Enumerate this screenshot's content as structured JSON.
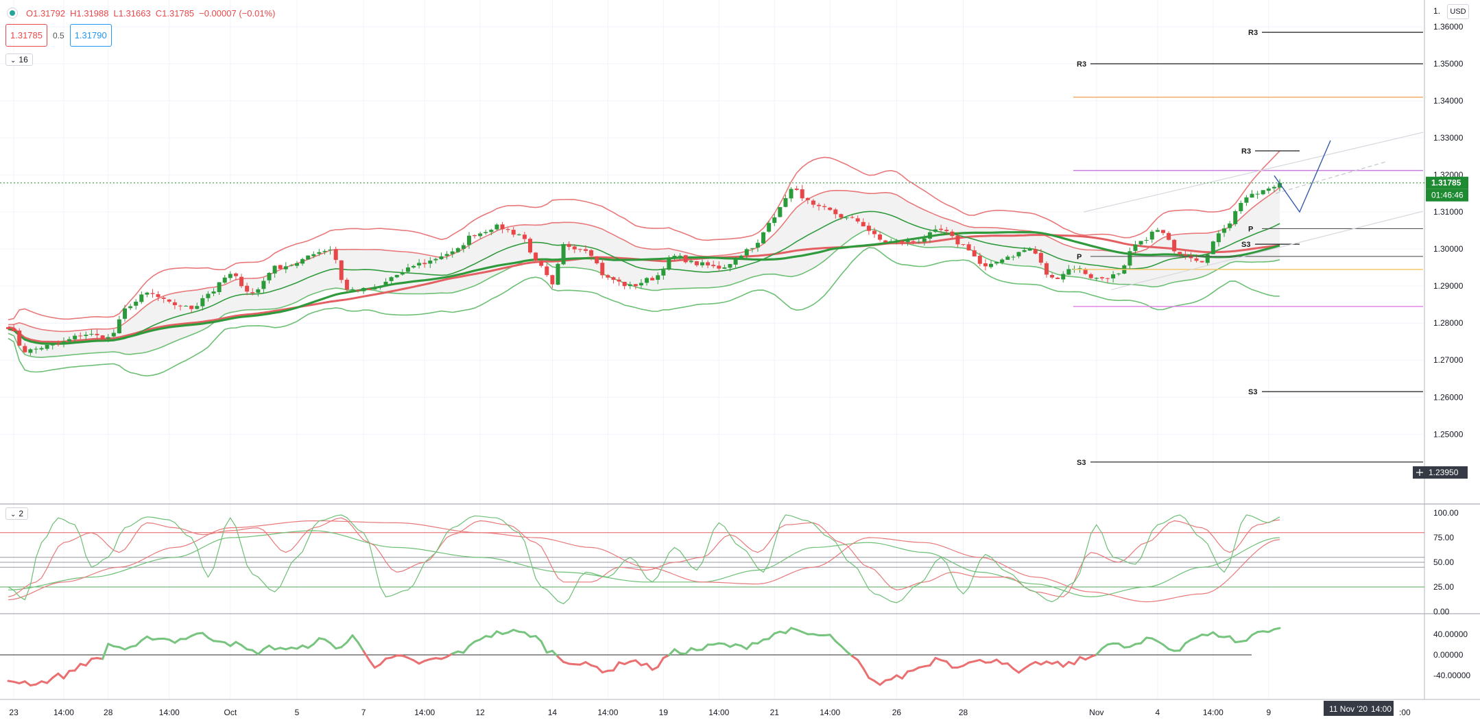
{
  "header": {
    "open": "O1.31792",
    "high": "H1.31988",
    "low": "L1.31663",
    "close": "C1.31785",
    "change": "−0.00007 (−0.01%)",
    "sell_price": "1.31785",
    "spread": "0.5",
    "buy_price": "1.31790",
    "indicators_count": "16"
  },
  "rsi_pane": {
    "indicators_count": "2"
  },
  "currency_button": "USD",
  "price_axis": {
    "ticks": [
      "1.36000",
      "1.35000",
      "1.34000",
      "1.33000",
      "1.32000",
      "1.31000",
      "1.30000",
      "1.29000",
      "1.28000",
      "1.27000",
      "1.26000",
      "1.25000"
    ],
    "top_tick": "1.",
    "last_price_label": "1.31785",
    "countdown_label": "01:46:46",
    "crosshair_label": "1.23950"
  },
  "stoch_axis": {
    "ticks": [
      "100.00",
      "75.00",
      "50.00",
      "25.00",
      "0.00"
    ]
  },
  "mom_axis": {
    "ticks": [
      "40.00000",
      "0.00000",
      "-40.00000"
    ]
  },
  "time_axis": {
    "labels": [
      {
        "text": "23",
        "i": 1
      },
      {
        "text": "14:00",
        "i": 10
      },
      {
        "text": "28",
        "i": 18
      },
      {
        "text": "14:00",
        "i": 29
      },
      {
        "text": "Oct",
        "i": 40
      },
      {
        "text": "5",
        "i": 52
      },
      {
        "text": "7",
        "i": 64
      },
      {
        "text": "14:00",
        "i": 75
      },
      {
        "text": "12",
        "i": 85
      },
      {
        "text": "14",
        "i": 98
      },
      {
        "text": "14:00",
        "i": 108
      },
      {
        "text": "19",
        "i": 118
      },
      {
        "text": "14:00",
        "i": 128
      },
      {
        "text": "21",
        "i": 138
      },
      {
        "text": "14:00",
        "i": 148
      },
      {
        "text": "26",
        "i": 160
      },
      {
        "text": "28",
        "i": 172
      },
      {
        "text": "Nov",
        "i": 196
      },
      {
        "text": "4",
        "i": 207
      },
      {
        "text": "14:00",
        "i": 217
      },
      {
        "text": "9",
        "i": 227
      }
    ],
    "cursor_label": "11 Nov '20",
    "cursor_time": "14:00",
    "last_label": ":00"
  },
  "colors": {
    "up": "#2b9a3a",
    "down": "#e8474a",
    "bb_upper": "#e8787a",
    "bb_lower": "#6cbf74",
    "ma_fast": "#2f9a3c",
    "ma_slow": "#e35f62",
    "fill": "#f2f2f2"
  },
  "chart_data": [
    {
      "type": "candlestick",
      "title": "",
      "xlabel": "",
      "ylabel": "",
      "ylim": [
        1.2395,
        1.36
      ],
      "bar_count": 230,
      "anchors": [
        [
          0,
          1.279
        ],
        [
          3,
          1.2725
        ],
        [
          8,
          1.274
        ],
        [
          14,
          1.277
        ],
        [
          18,
          1.276
        ],
        [
          22,
          1.285
        ],
        [
          25,
          1.288
        ],
        [
          30,
          1.285
        ],
        [
          33,
          1.284
        ],
        [
          36,
          1.288
        ],
        [
          40,
          1.293
        ],
        [
          44,
          1.288
        ],
        [
          48,
          1.295
        ],
        [
          52,
          1.296
        ],
        [
          55,
          1.299
        ],
        [
          58,
          1.3
        ],
        [
          61,
          1.289
        ],
        [
          66,
          1.289
        ],
        [
          70,
          1.293
        ],
        [
          74,
          1.296
        ],
        [
          80,
          1.299
        ],
        [
          84,
          1.304
        ],
        [
          88,
          1.306
        ],
        [
          92,
          1.304
        ],
        [
          96,
          1.295
        ],
        [
          98,
          1.29
        ],
        [
          100,
          1.301
        ],
        [
          104,
          1.3
        ],
        [
          108,
          1.292
        ],
        [
          112,
          1.29
        ],
        [
          116,
          1.292
        ],
        [
          120,
          1.298
        ],
        [
          124,
          1.296
        ],
        [
          128,
          1.295
        ],
        [
          134,
          1.3
        ],
        [
          138,
          1.309
        ],
        [
          141,
          1.316
        ],
        [
          146,
          1.311
        ],
        [
          152,
          1.308
        ],
        [
          158,
          1.302
        ],
        [
          163,
          1.302
        ],
        [
          168,
          1.305
        ],
        [
          172,
          1.301
        ],
        [
          176,
          1.295
        ],
        [
          180,
          1.298
        ],
        [
          184,
          1.3
        ],
        [
          188,
          1.292
        ],
        [
          192,
          1.295
        ],
        [
          196,
          1.292
        ],
        [
          200,
          1.293
        ],
        [
          203,
          1.301
        ],
        [
          207,
          1.305
        ],
        [
          211,
          1.299
        ],
        [
          215,
          1.297
        ],
        [
          219,
          1.306
        ],
        [
          223,
          1.314
        ],
        [
          227,
          1.316
        ],
        [
          229,
          1.3178
        ]
      ],
      "last_close": 1.31785,
      "pivot_levels": [
        {
          "label": "R3",
          "price": 1.3585,
          "span": "weekly"
        },
        {
          "label": "R3",
          "price": 1.35,
          "span": "monthly"
        },
        {
          "label": "R3",
          "price": 1.3265,
          "span": "daily"
        },
        {
          "label": "P",
          "price": 1.3055,
          "span": "weekly"
        },
        {
          "label": "S3",
          "price": 1.3013,
          "span": "daily"
        },
        {
          "label": "P",
          "price": 1.298,
          "span": "monthly"
        },
        {
          "label": "S3",
          "price": 1.2615,
          "span": "weekly"
        },
        {
          "label": "S3",
          "price": 1.2425,
          "span": "monthly"
        }
      ],
      "horizontal_lines": [
        {
          "price": 1.341,
          "color": "#f5a65b"
        },
        {
          "price": 1.3212,
          "color": "#c77ddb"
        },
        {
          "price": 1.2945,
          "color": "#f5c86b"
        },
        {
          "price": 1.2845,
          "color": "#e07be6"
        }
      ]
    },
    {
      "type": "line",
      "title": "",
      "ylim": [
        0,
        100
      ],
      "reference_levels": [
        80,
        55,
        50,
        45,
        25
      ],
      "fast_anchors": [
        [
          0,
          25
        ],
        [
          3,
          12
        ],
        [
          6,
          70
        ],
        [
          9,
          95
        ],
        [
          12,
          88
        ],
        [
          15,
          45
        ],
        [
          18,
          55
        ],
        [
          21,
          85
        ],
        [
          25,
          96
        ],
        [
          29,
          93
        ],
        [
          33,
          75
        ],
        [
          36,
          35
        ],
        [
          40,
          95
        ],
        [
          44,
          38
        ],
        [
          48,
          20
        ],
        [
          52,
          55
        ],
        [
          56,
          92
        ],
        [
          60,
          98
        ],
        [
          64,
          80
        ],
        [
          68,
          15
        ],
        [
          72,
          22
        ],
        [
          76,
          55
        ],
        [
          80,
          85
        ],
        [
          84,
          97
        ],
        [
          88,
          95
        ],
        [
          92,
          80
        ],
        [
          96,
          25
        ],
        [
          100,
          8
        ],
        [
          104,
          40
        ],
        [
          108,
          35
        ],
        [
          112,
          55
        ],
        [
          116,
          30
        ],
        [
          120,
          65
        ],
        [
          124,
          42
        ],
        [
          128,
          90
        ],
        [
          132,
          65
        ],
        [
          136,
          40
        ],
        [
          140,
          98
        ],
        [
          144,
          92
        ],
        [
          148,
          75
        ],
        [
          152,
          48
        ],
        [
          156,
          18
        ],
        [
          160,
          9
        ],
        [
          164,
          28
        ],
        [
          168,
          55
        ],
        [
          172,
          18
        ],
        [
          176,
          58
        ],
        [
          180,
          40
        ],
        [
          184,
          22
        ],
        [
          188,
          10
        ],
        [
          192,
          30
        ],
        [
          196,
          88
        ],
        [
          199,
          55
        ],
        [
          203,
          48
        ],
        [
          207,
          88
        ],
        [
          211,
          98
        ],
        [
          215,
          74
        ],
        [
          219,
          40
        ],
        [
          223,
          98
        ],
        [
          227,
          90
        ],
        [
          229,
          96
        ]
      ],
      "slow_anchors": [
        [
          0,
          15
        ],
        [
          5,
          30
        ],
        [
          10,
          70
        ],
        [
          15,
          80
        ],
        [
          20,
          60
        ],
        [
          25,
          90
        ],
        [
          30,
          85
        ],
        [
          35,
          78
        ],
        [
          40,
          82
        ],
        [
          45,
          85
        ],
        [
          50,
          60
        ],
        [
          55,
          85
        ],
        [
          60,
          95
        ],
        [
          65,
          70
        ],
        [
          70,
          40
        ],
        [
          75,
          50
        ],
        [
          80,
          78
        ],
        [
          85,
          92
        ],
        [
          90,
          88
        ],
        [
          95,
          70
        ],
        [
          100,
          30
        ],
        [
          105,
          30
        ],
        [
          110,
          45
        ],
        [
          115,
          42
        ],
        [
          120,
          50
        ],
        [
          125,
          55
        ],
        [
          130,
          78
        ],
        [
          135,
          60
        ],
        [
          140,
          88
        ],
        [
          145,
          90
        ],
        [
          150,
          70
        ],
        [
          155,
          45
        ],
        [
          160,
          22
        ],
        [
          165,
          30
        ],
        [
          170,
          40
        ],
        [
          175,
          35
        ],
        [
          180,
          35
        ],
        [
          185,
          20
        ],
        [
          190,
          15
        ],
        [
          195,
          60
        ],
        [
          200,
          50
        ],
        [
          205,
          70
        ],
        [
          210,
          92
        ],
        [
          215,
          85
        ],
        [
          220,
          60
        ],
        [
          225,
          88
        ],
        [
          229,
          93
        ]
      ],
      "trend_up_anchors": [
        [
          0,
          22
        ],
        [
          15,
          35
        ],
        [
          30,
          55
        ],
        [
          40,
          75
        ],
        [
          55,
          82
        ],
        [
          70,
          65
        ],
        [
          85,
          55
        ],
        [
          100,
          40
        ],
        [
          115,
          30
        ],
        [
          125,
          30
        ],
        [
          135,
          42
        ],
        [
          145,
          65
        ],
        [
          155,
          70
        ],
        [
          165,
          60
        ],
        [
          175,
          40
        ],
        [
          185,
          28
        ],
        [
          195,
          15
        ],
        [
          205,
          25
        ],
        [
          215,
          45
        ],
        [
          229,
          75
        ]
      ],
      "trend_down_anchors": [
        [
          0,
          12
        ],
        [
          10,
          30
        ],
        [
          20,
          45
        ],
        [
          30,
          65
        ],
        [
          40,
          85
        ],
        [
          55,
          92
        ],
        [
          70,
          90
        ],
        [
          85,
          80
        ],
        [
          95,
          75
        ],
        [
          105,
          65
        ],
        [
          115,
          45
        ],
        [
          125,
          30
        ],
        [
          135,
          28
        ],
        [
          145,
          45
        ],
        [
          155,
          75
        ],
        [
          165,
          70
        ],
        [
          175,
          55
        ],
        [
          185,
          35
        ],
        [
          195,
          20
        ],
        [
          205,
          10
        ],
        [
          215,
          18
        ],
        [
          229,
          73
        ]
      ]
    },
    {
      "type": "line",
      "title": "",
      "ylim": [
        -60,
        62
      ],
      "zero_line": 0,
      "anchors": [
        [
          0,
          -50
        ],
        [
          5,
          -55
        ],
        [
          10,
          -40
        ],
        [
          14,
          -15
        ],
        [
          17,
          -5
        ],
        [
          18,
          20
        ],
        [
          22,
          10
        ],
        [
          26,
          35
        ],
        [
          30,
          28
        ],
        [
          34,
          40
        ],
        [
          38,
          30
        ],
        [
          41,
          20
        ],
        [
          44,
          5
        ],
        [
          48,
          15
        ],
        [
          52,
          10
        ],
        [
          56,
          28
        ],
        [
          60,
          15
        ],
        [
          62,
          35
        ],
        [
          64,
          10
        ],
        [
          66,
          -20
        ],
        [
          70,
          -5
        ],
        [
          74,
          -15
        ],
        [
          78,
          -8
        ],
        [
          82,
          8
        ],
        [
          86,
          38
        ],
        [
          90,
          45
        ],
        [
          94,
          40
        ],
        [
          98,
          5
        ],
        [
          100,
          -10
        ],
        [
          104,
          -20
        ],
        [
          108,
          -30
        ],
        [
          112,
          -10
        ],
        [
          116,
          -25
        ],
        [
          120,
          5
        ],
        [
          124,
          10
        ],
        [
          128,
          20
        ],
        [
          132,
          15
        ],
        [
          136,
          30
        ],
        [
          140,
          48
        ],
        [
          144,
          40
        ],
        [
          148,
          35
        ],
        [
          152,
          -5
        ],
        [
          156,
          -55
        ],
        [
          160,
          -45
        ],
        [
          164,
          -25
        ],
        [
          168,
          -5
        ],
        [
          170,
          -20
        ],
        [
          174,
          -15
        ],
        [
          178,
          -8
        ],
        [
          182,
          -35
        ],
        [
          186,
          -15
        ],
        [
          190,
          -20
        ],
        [
          194,
          -8
        ],
        [
          198,
          20
        ],
        [
          202,
          15
        ],
        [
          206,
          30
        ],
        [
          210,
          10
        ],
        [
          214,
          35
        ],
        [
          218,
          40
        ],
        [
          222,
          25
        ],
        [
          226,
          48
        ],
        [
          229,
          52
        ]
      ]
    }
  ]
}
